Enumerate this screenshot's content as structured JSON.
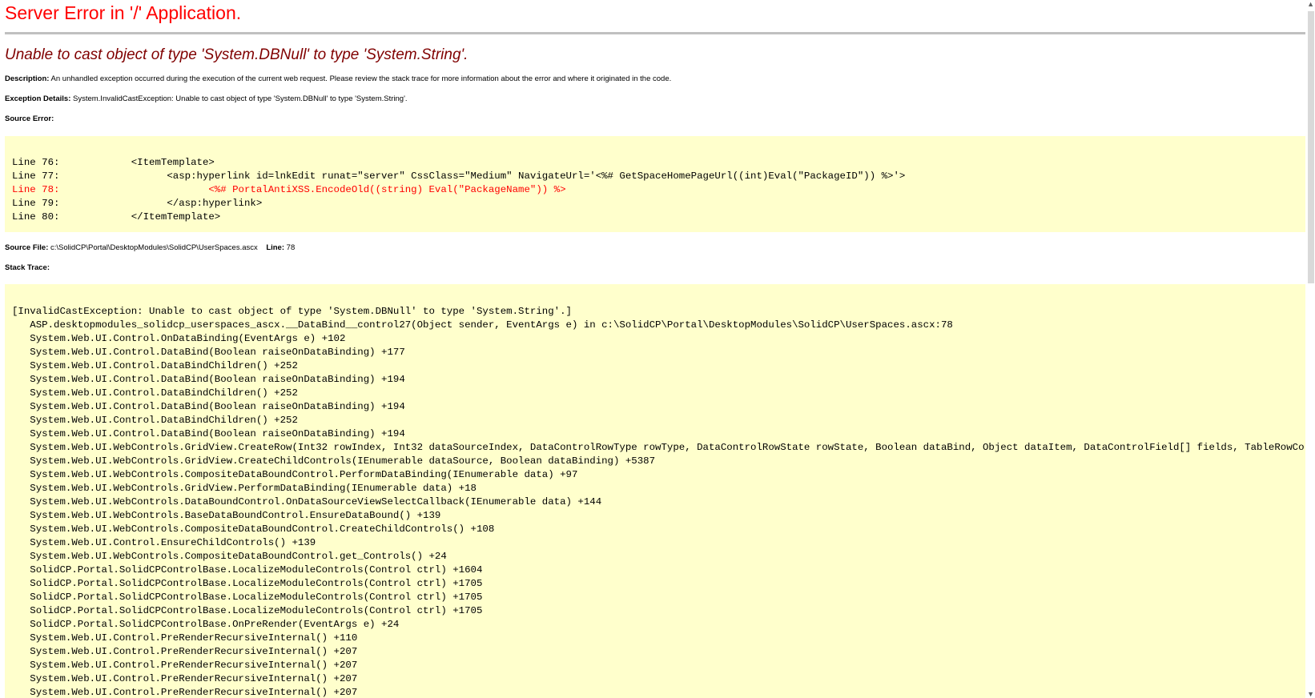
{
  "heading": "Server Error in '/' Application.",
  "error_message": "Unable to cast object of type 'System.DBNull' to type 'System.String'.",
  "description": {
    "label": "Description:",
    "text": " An unhandled exception occurred during the execution of the current web request. Please review the stack trace for more information about the error and where it originated in the code."
  },
  "exception": {
    "label": "Exception Details:",
    "text": " System.InvalidCastException: Unable to cast object of type 'System.DBNull' to type 'System.String'."
  },
  "source_error": {
    "label": "Source Error:",
    "lines": [
      {
        "text": "Line 76:            <ItemTemplate>",
        "is_error": false
      },
      {
        "text": "Line 77:                  <asp:hyperlink id=lnkEdit runat=\"server\" CssClass=\"Medium\" NavigateUrl='<%# GetSpaceHomePageUrl((int)Eval(\"PackageID\")) %>'>",
        "is_error": false
      },
      {
        "text": "Line 78:                         <%# PortalAntiXSS.EncodeOld((string) Eval(\"PackageName\")) %>",
        "is_error": true
      },
      {
        "text": "Line 79:                  </asp:hyperlink>",
        "is_error": false
      },
      {
        "text": "Line 80:            </ItemTemplate>",
        "is_error": false
      }
    ]
  },
  "source_file": {
    "label": "Source File:",
    "path": " c:\\SolidCP\\Portal\\DesktopModules\\SolidCP\\UserSpaces.ascx",
    "line_label": "Line:",
    "line_value": " 78"
  },
  "stack_trace": {
    "label": "Stack Trace:",
    "lines": [
      "[InvalidCastException: Unable to cast object of type 'System.DBNull' to type 'System.String'.]",
      "   ASP.desktopmodules_solidcp_userspaces_ascx.__DataBind__control27(Object sender, EventArgs e) in c:\\SolidCP\\Portal\\DesktopModules\\SolidCP\\UserSpaces.ascx:78",
      "   System.Web.UI.Control.OnDataBinding(EventArgs e) +102",
      "   System.Web.UI.Control.DataBind(Boolean raiseOnDataBinding) +177",
      "   System.Web.UI.Control.DataBindChildren() +252",
      "   System.Web.UI.Control.DataBind(Boolean raiseOnDataBinding) +194",
      "   System.Web.UI.Control.DataBindChildren() +252",
      "   System.Web.UI.Control.DataBind(Boolean raiseOnDataBinding) +194",
      "   System.Web.UI.Control.DataBindChildren() +252",
      "   System.Web.UI.Control.DataBind(Boolean raiseOnDataBinding) +194",
      "   System.Web.UI.WebControls.GridView.CreateRow(Int32 rowIndex, Int32 dataSourceIndex, DataControlRowType rowType, DataControlRowState rowState, Boolean dataBind, Object dataItem, DataControlField[] fields, TableRowCollection rows, Pa",
      "   System.Web.UI.WebControls.GridView.CreateChildControls(IEnumerable dataSource, Boolean dataBinding) +5387",
      "   System.Web.UI.WebControls.CompositeDataBoundControl.PerformDataBinding(IEnumerable data) +97",
      "   System.Web.UI.WebControls.GridView.PerformDataBinding(IEnumerable data) +18",
      "   System.Web.UI.WebControls.DataBoundControl.OnDataSourceViewSelectCallback(IEnumerable data) +144",
      "   System.Web.UI.WebControls.BaseDataBoundControl.EnsureDataBound() +139",
      "   System.Web.UI.WebControls.CompositeDataBoundControl.CreateChildControls() +108",
      "   System.Web.UI.Control.EnsureChildControls() +139",
      "   System.Web.UI.WebControls.CompositeDataBoundControl.get_Controls() +24",
      "   SolidCP.Portal.SolidCPControlBase.LocalizeModuleControls(Control ctrl) +1604",
      "   SolidCP.Portal.SolidCPControlBase.LocalizeModuleControls(Control ctrl) +1705",
      "   SolidCP.Portal.SolidCPControlBase.LocalizeModuleControls(Control ctrl) +1705",
      "   SolidCP.Portal.SolidCPControlBase.LocalizeModuleControls(Control ctrl) +1705",
      "   SolidCP.Portal.SolidCPControlBase.OnPreRender(EventArgs e) +24",
      "   System.Web.UI.Control.PreRenderRecursiveInternal() +110",
      "   System.Web.UI.Control.PreRenderRecursiveInternal() +207",
      "   System.Web.UI.Control.PreRenderRecursiveInternal() +207",
      "   System.Web.UI.Control.PreRenderRecursiveInternal() +207",
      "   System.Web.UI.Control.PreRenderRecursiveInternal() +207"
    ]
  },
  "colors": {
    "heading": "#ff0000",
    "error_message": "#800000",
    "code_background": "#ffffcc",
    "error_line": "#ff0000"
  }
}
